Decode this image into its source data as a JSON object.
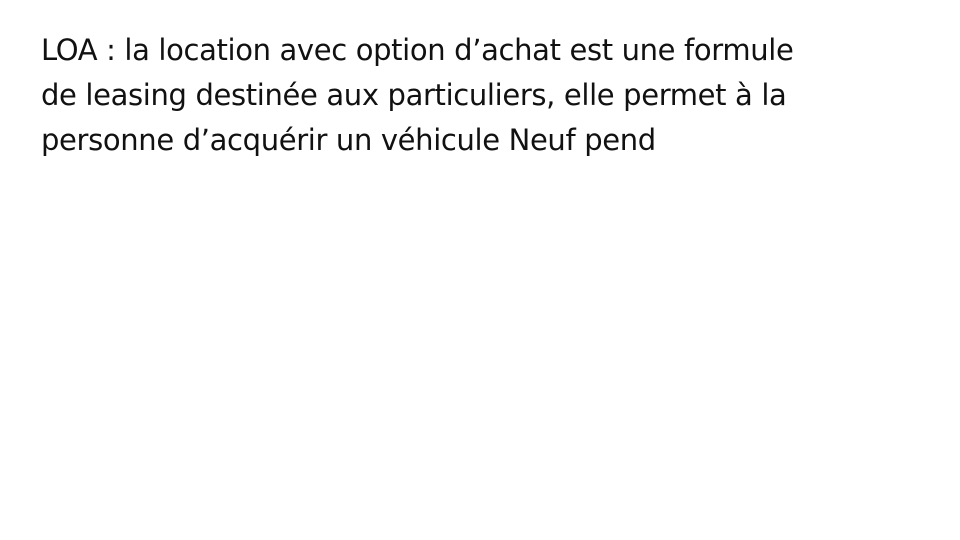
{
  "slide": {
    "lines": [
      "LOA : la location avec option d’achat est une formule",
      "de leasing destinée aux particuliers, elle permet à la",
      "personne d’acquérir un véhicule Neuf pend"
    ]
  }
}
